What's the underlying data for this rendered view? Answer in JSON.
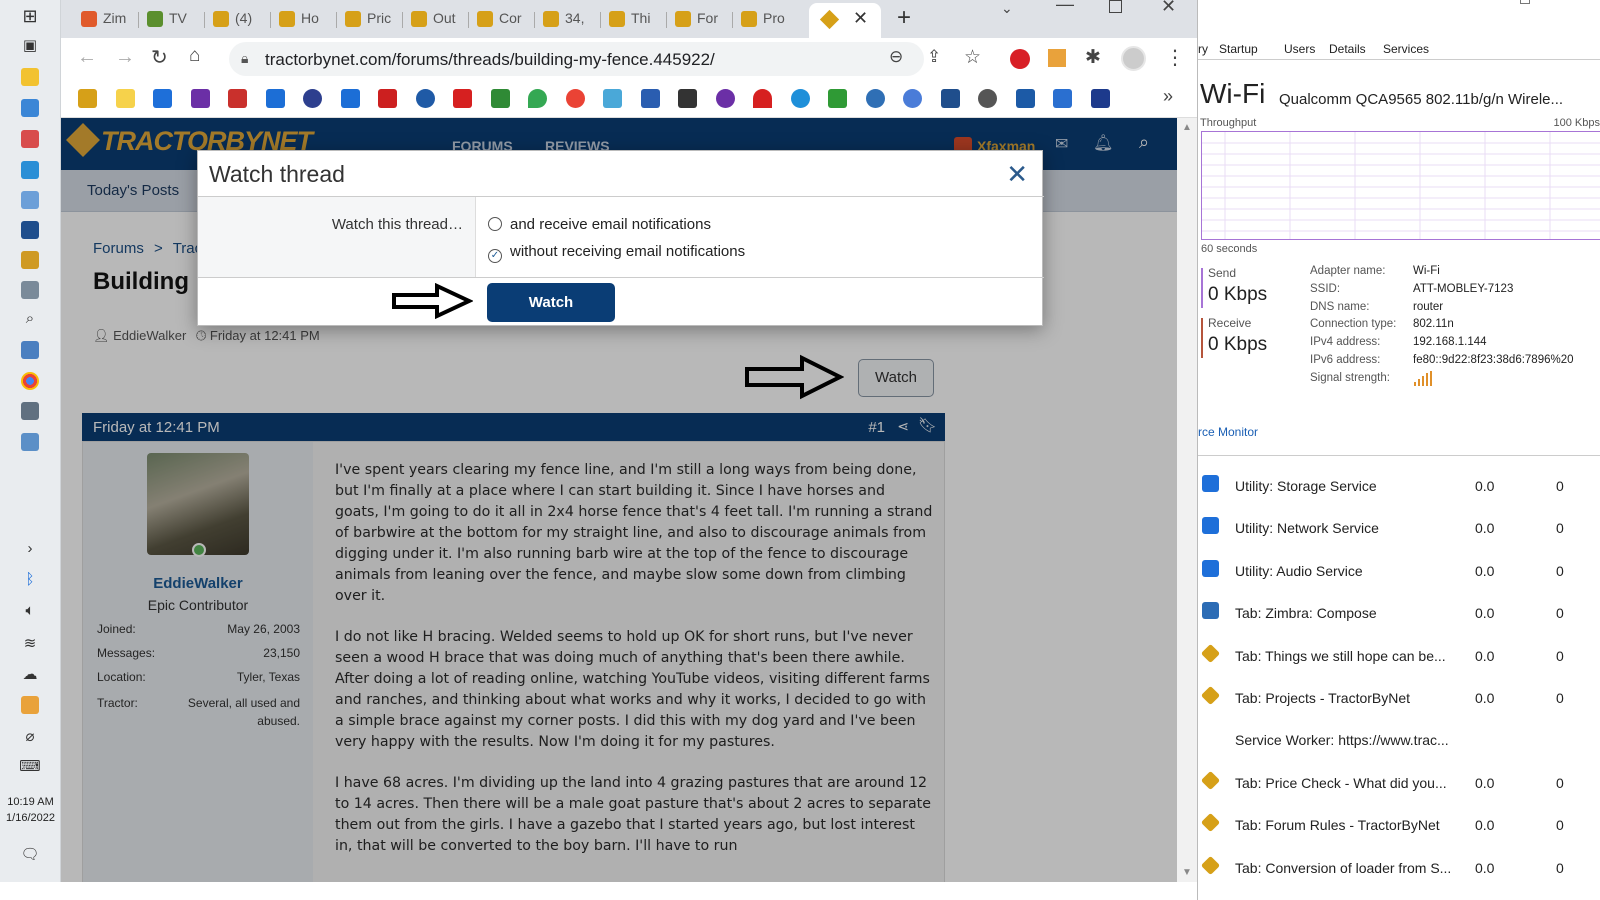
{
  "system": {
    "time": "10:19 AM",
    "date": "1/16/2022"
  },
  "browser": {
    "tabs": [
      {
        "title": "Zim",
        "color": "#e05a2b"
      },
      {
        "title": "TV",
        "color": "#5b8f2e"
      },
      {
        "title": "(4)",
        "color": "#d6a018"
      },
      {
        "title": "Ho",
        "color": "#d6a018"
      },
      {
        "title": "Pric",
        "color": "#d6a018"
      },
      {
        "title": "Out",
        "color": "#d6a018"
      },
      {
        "title": "Cor",
        "color": "#d6a018"
      },
      {
        "title": "34,",
        "color": "#d6a018"
      },
      {
        "title": "Thi",
        "color": "#d6a018"
      },
      {
        "title": "For",
        "color": "#d6a018"
      },
      {
        "title": "Pro",
        "color": "#d6a018"
      }
    ],
    "url": "tractorbynet.com/forums/threads/building-my-fence.445922/",
    "new_tab": "+",
    "bookmarks_more": "»"
  },
  "site": {
    "logo": "TRACTORBYNET",
    "nav": [
      "FORUMS",
      "REVIEWS"
    ],
    "user": "Xfaxman",
    "subnav_today": "Today's Posts"
  },
  "thread": {
    "breadcrumb_forums": "Forums",
    "breadcrumb_sep": ">",
    "breadcrumb_next": "Tract",
    "title": "Building my Fence",
    "author": "EddieWalker",
    "posted": "Friday at 12:41 PM",
    "watch_label": "Watch"
  },
  "post": {
    "date": "Friday at 12:41 PM",
    "number": "#1",
    "username": "EddieWalker",
    "user_title": "Epic Contributor",
    "stats": [
      {
        "label": "Joined:",
        "value": "May 26, 2003"
      },
      {
        "label": "Messages:",
        "value": "23,150"
      },
      {
        "label": "Location:",
        "value": "Tyler, Texas"
      },
      {
        "label": "Tractor:",
        "value": "Several, all used and abused."
      }
    ],
    "paragraphs": [
      "I've spent years clearing my fence line, and I'm still a long ways from being done, but I'm finally at a place where I can start building it. Since I have horses and goats, I'm going to do it all in 2x4 horse fence that's 4 feet tall. I'm running a strand of barbwire at the bottom for my straight line, and also to discourage animals from digging under it. I'm also running barb wire at the top of the fence to discourage animals from leaning over the fence, and maybe slow some down from climbing over it.",
      "I do not like H bracing. Welded seems to hold up OK for short runs, but I've never seen a wood H brace that was doing much of anything that's been there awhile. After doing a lot of reading online, watching YouTube videos, visiting different farms and ranches, and thinking about what works and why it works, I decided to go with a simple brace against my corner posts. I did this with my dog yard and I've been very happy with the results. Now I'm doing it for my pastures.",
      "I have 68 acres. I'm dividing up the land into 4 grazing pastures that are around 12 to 14 acres. Then there will be a male goat pasture that's about 2 acres to separate them out from the girls. I have a gazebo that I started years ago, but lost interest in, that will be converted to the boy barn. I'll have to run"
    ]
  },
  "modal": {
    "title": "Watch thread",
    "close": "✕",
    "label": "Watch this thread…",
    "options": [
      {
        "label": "and receive email notifications",
        "checked": false
      },
      {
        "label": "without receiving email notifications",
        "checked": true
      }
    ],
    "button": "Watch"
  },
  "task_manager": {
    "tabs": [
      "ry",
      "Startup",
      "Users",
      "Details",
      "Services"
    ],
    "title": "Wi-Fi",
    "adapter": "Qualcomm QCA9565 802.11b/g/n Wirele...",
    "throughput_label": "Throughput",
    "throughput_max": "100 Kbps",
    "seconds_label": "60 seconds",
    "send_label": "Send",
    "send_value": "0 Kbps",
    "receive_label": "Receive",
    "receive_value": "0 Kbps",
    "details": [
      {
        "k": "Adapter name:",
        "v": "Wi-Fi"
      },
      {
        "k": "SSID:",
        "v": "ATT-MOBLEY-7123"
      },
      {
        "k": "DNS name:",
        "v": "router"
      },
      {
        "k": "Connection type:",
        "v": "802.11n"
      },
      {
        "k": "IPv4 address:",
        "v": "192.168.1.144"
      },
      {
        "k": "IPv6 address:",
        "v": "fe80::9d22:8f23:38d6:7896%20"
      },
      {
        "k": "Signal strength:",
        "v": ""
      }
    ],
    "resource_monitor_link": "rce Monitor",
    "processes": [
      {
        "name": "Utility: Storage Service",
        "v1": "0.0",
        "v2": "0",
        "icon": "puzzle-icon",
        "color": "#1e6fd9"
      },
      {
        "name": "Utility: Network Service",
        "v1": "0.0",
        "v2": "0",
        "icon": "puzzle-icon",
        "color": "#1e6fd9"
      },
      {
        "name": "Utility: Audio Service",
        "v1": "0.0",
        "v2": "0",
        "icon": "puzzle-icon",
        "color": "#1e6fd9"
      },
      {
        "name": "Tab: Zimbra: Compose",
        "v1": "0.0",
        "v2": "0",
        "icon": "zimbra-icon",
        "color": "#2c6cb5"
      },
      {
        "name": "Tab: Things we still hope can be...",
        "v1": "0.0",
        "v2": "0",
        "icon": "tbn-icon",
        "color": "#d6a018"
      },
      {
        "name": "Tab: Projects - TractorByNet",
        "v1": "0.0",
        "v2": "0",
        "icon": "tbn-icon",
        "color": "#d6a018"
      },
      {
        "name": "Service Worker: https://www.trac...",
        "v1": "",
        "v2": "",
        "icon": "",
        "color": ""
      },
      {
        "name": "Tab: Price Check - What did you...",
        "v1": "0.0",
        "v2": "0",
        "icon": "tbn-icon",
        "color": "#d6a018"
      },
      {
        "name": "Tab: Forum Rules - TractorByNet",
        "v1": "0.0",
        "v2": "0",
        "icon": "tbn-icon",
        "color": "#d6a018"
      },
      {
        "name": "Tab: Conversion of loader from S...",
        "v1": "0.0",
        "v2": "0",
        "icon": "tbn-icon",
        "color": "#d6a018"
      }
    ]
  }
}
